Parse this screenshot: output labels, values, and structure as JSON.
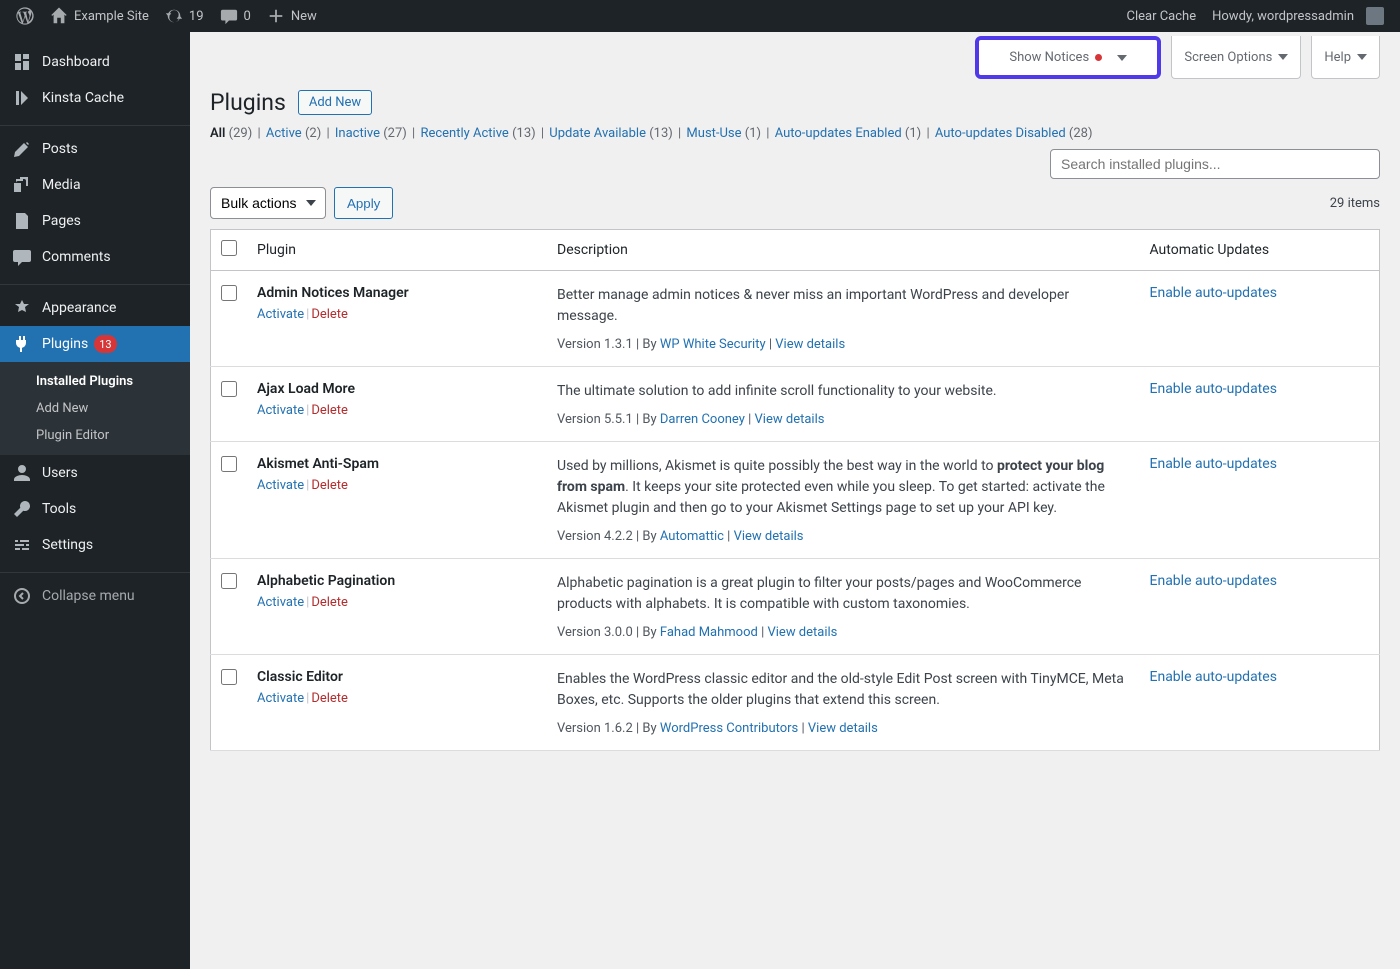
{
  "adminbar": {
    "site_name": "Example Site",
    "updates": "19",
    "comments": "0",
    "new": "New",
    "clear_cache": "Clear Cache",
    "howdy": "Howdy, wordpressadmin"
  },
  "sidebar": {
    "dashboard": "Dashboard",
    "kinsta": "Kinsta Cache",
    "posts": "Posts",
    "media": "Media",
    "pages": "Pages",
    "comments": "Comments",
    "appearance": "Appearance",
    "plugins": "Plugins",
    "plugins_badge": "13",
    "users": "Users",
    "tools": "Tools",
    "settings": "Settings",
    "collapse": "Collapse menu",
    "sub": {
      "installed": "Installed Plugins",
      "addnew": "Add New",
      "editor": "Plugin Editor"
    }
  },
  "tabs": {
    "show_notices": "Show Notices",
    "screen_options": "Screen Options",
    "help": "Help"
  },
  "page": {
    "title": "Plugins",
    "add_new": "Add New"
  },
  "filters": {
    "all": "All",
    "all_c": "(29)",
    "active": "Active",
    "active_c": "(2)",
    "inactive": "Inactive",
    "inactive_c": "(27)",
    "recent": "Recently Active",
    "recent_c": "(13)",
    "update": "Update Available",
    "update_c": "(13)",
    "mustuse": "Must-Use",
    "mustuse_c": "(1)",
    "auto_en": "Auto-updates Enabled",
    "auto_en_c": "(1)",
    "auto_dis": "Auto-updates Disabled",
    "auto_dis_c": "(28)"
  },
  "search_placeholder": "Search installed plugins...",
  "bulk": {
    "label": "Bulk actions",
    "apply": "Apply"
  },
  "count": "29 items",
  "cols": {
    "plugin": "Plugin",
    "desc": "Description",
    "auto": "Automatic Updates"
  },
  "actions": {
    "activate": "Activate",
    "delete": "Delete",
    "enable_auto": "Enable auto-updates",
    "view_details": "View details"
  },
  "plugins": [
    {
      "name": "Admin Notices Manager",
      "desc": "Better manage admin notices & never miss an important WordPress and developer message.",
      "ver": "Version 1.3.1",
      "by": "By ",
      "author": "WP White Security"
    },
    {
      "name": "Ajax Load More",
      "desc": "The ultimate solution to add infinite scroll functionality to your website.",
      "ver": "Version 5.5.1",
      "by": "By ",
      "author": "Darren Cooney"
    },
    {
      "name": "Akismet Anti-Spam",
      "desc_pre": "Used by millions, Akismet is quite possibly the best way in the world to ",
      "desc_bold": "protect your blog from spam",
      "desc_post": ". It keeps your site protected even while you sleep. To get started: activate the Akismet plugin and then go to your Akismet Settings page to set up your API key.",
      "ver": "Version 4.2.2",
      "by": "By ",
      "author": "Automattic"
    },
    {
      "name": "Alphabetic Pagination",
      "desc": "Alphabetic pagination is a great plugin to filter your posts/pages and WooCommerce products with alphabets. It is compatible with custom taxonomies.",
      "ver": "Version 3.0.0",
      "by": "By ",
      "author": "Fahad Mahmood"
    },
    {
      "name": "Classic Editor",
      "desc": "Enables the WordPress classic editor and the old-style Edit Post screen with TinyMCE, Meta Boxes, etc. Supports the older plugins that extend this screen.",
      "ver": "Version 1.6.2",
      "by": "By ",
      "author": "WordPress Contributors"
    }
  ]
}
